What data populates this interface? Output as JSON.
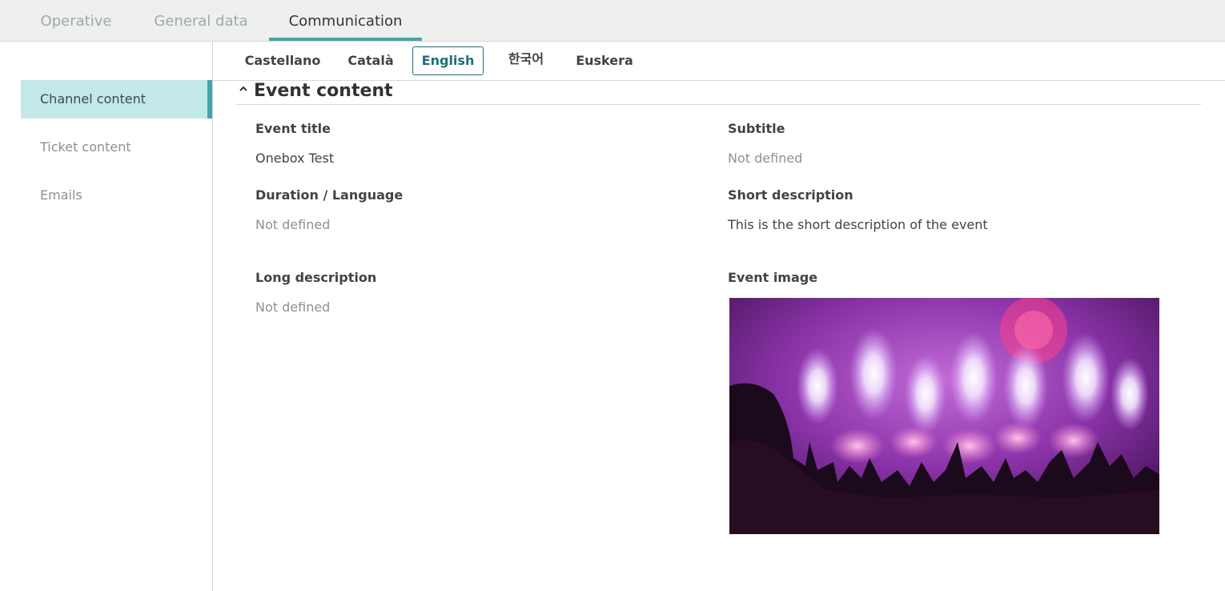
{
  "top_tabs": [
    {
      "label": "Operative"
    },
    {
      "label": "General data"
    },
    {
      "label": "Communication"
    }
  ],
  "sidebar": {
    "items": [
      {
        "label": "Channel content"
      },
      {
        "label": "Ticket content"
      },
      {
        "label": "Emails"
      }
    ]
  },
  "languages": [
    {
      "label": "Castellano"
    },
    {
      "label": "Català"
    },
    {
      "label": "English"
    },
    {
      "label": "한국어"
    },
    {
      "label": "Euskera"
    }
  ],
  "section": {
    "title": "Event content",
    "fields": {
      "event_title": {
        "label": "Event title",
        "value": "Onebox Test"
      },
      "subtitle": {
        "label": "Subtitle",
        "value": "Not defined"
      },
      "duration_language": {
        "label": "Duration / Language",
        "value": "Not defined"
      },
      "short_description": {
        "label": "Short description",
        "value": "This is the short description of the event"
      },
      "long_description": {
        "label": "Long description",
        "value": "Not defined"
      },
      "event_image": {
        "label": "Event image"
      }
    }
  },
  "colors": {
    "accent": "#46a3a8",
    "active_sidebar_bg": "#c3e8ea",
    "active_language_border": "#1f6f7a"
  }
}
